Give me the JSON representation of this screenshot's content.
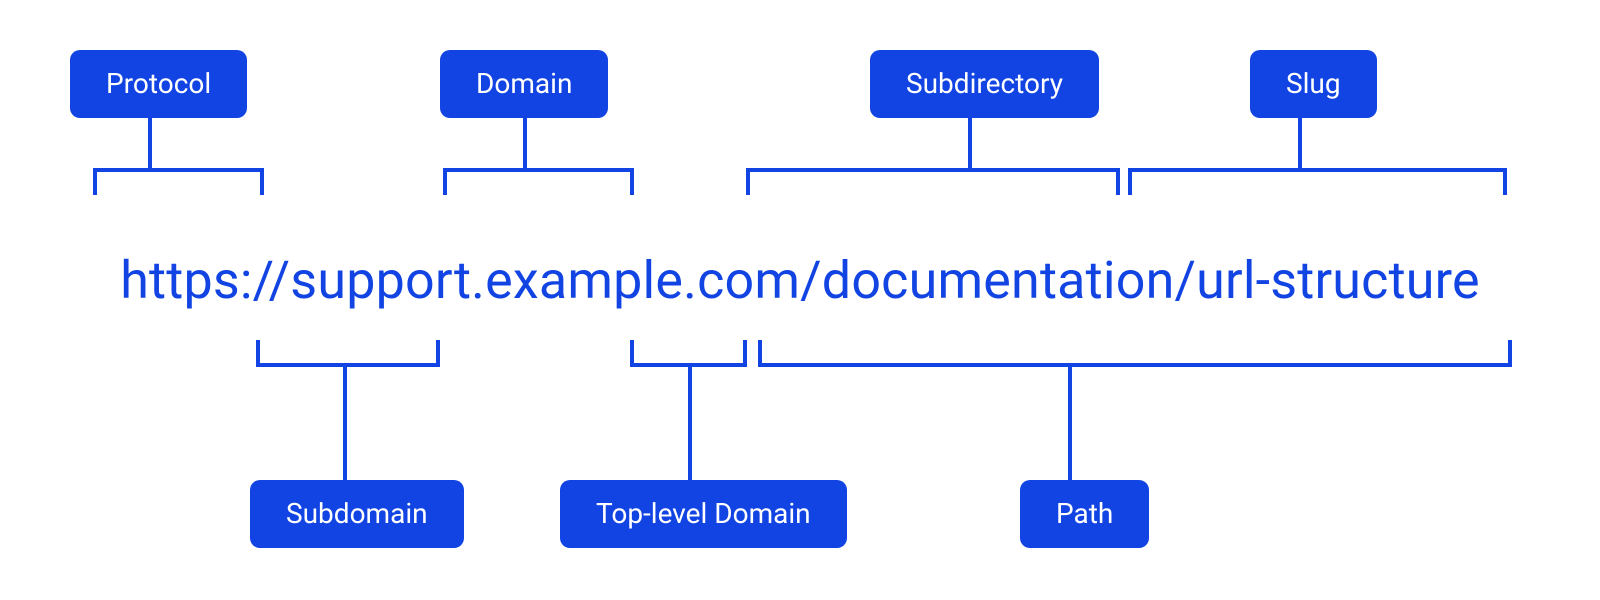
{
  "colors": {
    "accent": "#1244e3",
    "pill_bg": "#1244e3",
    "pill_fg": "#ffffff"
  },
  "url_text": "https://support.example.com/documentation/url-structure",
  "labels": {
    "protocol": "Protocol",
    "domain": "Domain",
    "subdirectory": "Subdirectory",
    "slug": "Slug",
    "subdomain": "Subdomain",
    "tld": "Top-level Domain",
    "path": "Path"
  },
  "segments": {
    "protocol": "https://",
    "subdomain": "support.",
    "domain": "example",
    "tld": ".com",
    "subdirectory": "/documentation",
    "slug": "/url-structure",
    "path": "/documentation/url-structure"
  }
}
